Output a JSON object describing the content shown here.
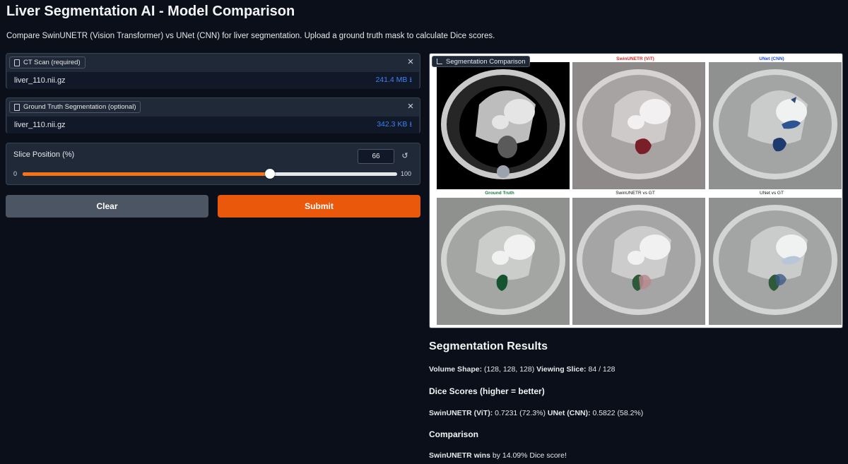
{
  "app": {
    "title": "Liver Segmentation AI - Model Comparison",
    "description": "Compare SwinUNETR (Vision Transformer) vs UNet (CNN) for liver segmentation. Upload a ground truth mask to calculate Dice scores."
  },
  "ct_upload": {
    "label": "CT Scan (required)",
    "file_name": "liver_110.nii.gz",
    "file_size": "241.4 MB ⭳",
    "close_icon": "×"
  },
  "gt_upload": {
    "label": "Ground Truth Segmentation (optional)",
    "file_name": "liver_110.nii.gz",
    "file_size": "342.3 KB ⭳",
    "close_icon": "×"
  },
  "slider": {
    "label": "Slice Position (%)",
    "value": "66",
    "value_fraction": 0.66,
    "min": "0",
    "max": "100",
    "reset_icon": "↺"
  },
  "buttons": {
    "clear": "Clear",
    "submit": "Submit"
  },
  "image_output": {
    "tag": "Segmentation Comparison",
    "panels": [
      {
        "title": "",
        "color": "#000000"
      },
      {
        "title": "SwinUNETR (ViT)",
        "color": "#dc2626"
      },
      {
        "title": "UNet (CNN)",
        "color": "#1d4ed8"
      },
      {
        "title": "Ground Truth",
        "color": "#15803d"
      },
      {
        "title": "SwinUNETR vs GT",
        "color": "#111111"
      },
      {
        "title": "UNet vs GT",
        "color": "#111111"
      }
    ]
  },
  "results": {
    "heading": "Segmentation Results",
    "volume_label": "Volume Shape:",
    "volume_value": " (128, 128, 128) ",
    "slice_label": "Viewing Slice:",
    "slice_value": " 84 / 128",
    "dice_heading": "Dice Scores (higher = better)",
    "swin_label": "SwinUNETR (ViT):",
    "swin_value": " 0.7231 (72.3%) ",
    "unet_label": "UNet (CNN):",
    "unet_value": " 0.5822 (58.2%)",
    "comparison_heading": "Comparison",
    "winner_label": "SwinUNETR wins",
    "winner_text": " by 14.09% Dice score!"
  }
}
